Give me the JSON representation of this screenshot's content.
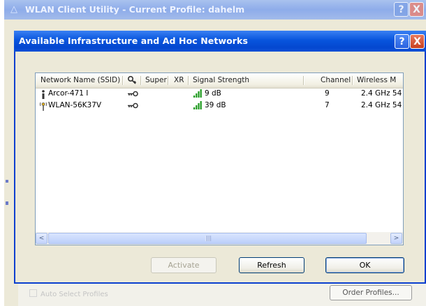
{
  "outer_window": {
    "title": "WLAN Client Utility - Current Profile: dahelm",
    "help_label": "?",
    "close_label": "X",
    "auto_select_label": "Auto Select Profiles",
    "order_profiles_label": "Order Profiles..."
  },
  "dialog": {
    "title": "Available Infrastructure and Ad Hoc Networks",
    "help_label": "?",
    "close_label": "X",
    "columns": [
      {
        "label": "Network Name (SSID)"
      },
      {
        "label": ""
      },
      {
        "label": "Super"
      },
      {
        "label": "XR"
      },
      {
        "label": "Signal Strength"
      },
      {
        "label": "Channel"
      },
      {
        "label": "Wireless M"
      }
    ],
    "networks": [
      {
        "icon": "ad-hoc-icon",
        "ssid": "Arcor-471 I",
        "secured": true,
        "super": "",
        "xr": "",
        "signal": "9 dB",
        "signal_level": 1.0,
        "channel": "9",
        "mode": "2.4 GHz 54"
      },
      {
        "icon": "infrastructure-icon",
        "ssid": "WLAN-56K37V",
        "secured": true,
        "super": "",
        "xr": "",
        "signal": "39 dB",
        "signal_level": 1.0,
        "channel": "7",
        "mode": "2.4 GHz 54"
      }
    ],
    "buttons": {
      "activate": "Activate",
      "refresh": "Refresh",
      "ok": "OK"
    },
    "scroll_left": "<",
    "scroll_right": ">"
  },
  "colors": {
    "dialog_title": "#0855dd",
    "outer_title": "#8eacea",
    "signal_green": "#1f9a1f"
  }
}
